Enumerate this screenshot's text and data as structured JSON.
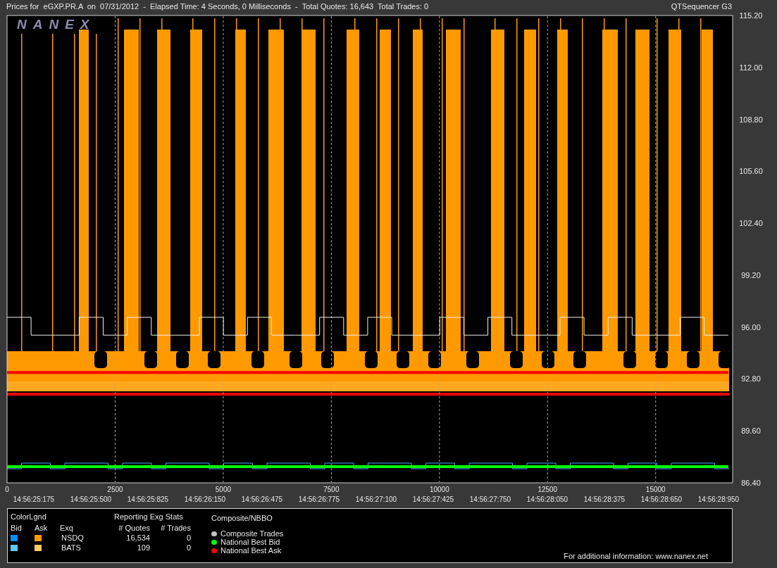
{
  "header": {
    "title": "Prices for  eGXP.PR.A  on  07/31/2012  -  Elapsed Time: 4 Seconds, 0 Milliseconds  -  Total Quotes: 16,643  Total Trades: 0",
    "app": "QTSequencer G3"
  },
  "chart": {
    "logo": "NANEX",
    "time_labels": [
      "14:56:25:175",
      "14:56:25:500",
      "14:56:25:825",
      "14:56:26:150",
      "14:56:26:475",
      "14:56:26:775",
      "14:56:27:100",
      "14:56:27:425",
      "14:56:27:750",
      "14:56:28:050",
      "14:56:28:375",
      "14:56:28:650",
      "14:56:28:950"
    ],
    "chart_data": {
      "type": "line",
      "grid": true,
      "xlim": [
        0,
        16780
      ],
      "ylim": [
        86.4,
        115.2
      ],
      "xticks": [
        0,
        2500,
        5000,
        7500,
        10000,
        12500,
        15000
      ],
      "yticks": [
        {
          "value": 86.4,
          "label": "86.40"
        },
        {
          "value": 89.6,
          "label": "89.60"
        },
        {
          "value": 92.8,
          "label": "92.80"
        },
        {
          "value": 96,
          "label": "96.00"
        },
        {
          "value": 99.2,
          "label": "99.20"
        },
        {
          "value": 102.4,
          "label": "102.40"
        },
        {
          "value": 105.6,
          "label": "105.60"
        },
        {
          "value": 108.8,
          "label": "108.80"
        },
        {
          "value": 112,
          "label": "112.00"
        },
        {
          "value": 115.2,
          "label": "115.20"
        }
      ],
      "x": [
        0,
        556,
        556,
        1112,
        1112,
        1668,
        1668,
        2224,
        2224,
        2780,
        2780,
        3336,
        3336,
        3892,
        3892,
        4448,
        4448,
        5004,
        5004,
        5560,
        5560,
        6116,
        6116,
        6672,
        6672,
        7228,
        7228,
        7784,
        7784,
        8340,
        8340,
        8896,
        8896,
        9452,
        9452,
        10008,
        10008,
        10564,
        10564,
        11120,
        11120,
        11676,
        11676,
        12232,
        12232,
        12788,
        12788,
        13344,
        13344,
        13900,
        13900,
        14456,
        14456,
        15012,
        15012,
        15568,
        15568,
        16124,
        16124,
        16680
      ],
      "series": [
        {
          "color": "#f0f0f0",
          "values": [
            96.6,
            96.6,
            95.5,
            95.5,
            95.5,
            95.5,
            96.6,
            96.6,
            95.5,
            95.5,
            96.6,
            96.6,
            95.5,
            95.5,
            95.5,
            95.5,
            96.6,
            96.6,
            95.5,
            95.5,
            96.6,
            96.6,
            95.5,
            95.5,
            95.5,
            95.5,
            96.6,
            96.6,
            95.5,
            95.5,
            96.6,
            96.6,
            95.5,
            95.5,
            95.5,
            95.5,
            96.6,
            96.6,
            95.5,
            95.5,
            96.6,
            96.6,
            95.5,
            95.5,
            95.5,
            95.5,
            96.6,
            96.6,
            95.5,
            95.5,
            96.6,
            96.6,
            95.5,
            95.5,
            95.5,
            95.5,
            96.6,
            96.6,
            95.5,
            95.5
          ]
        },
        {
          "name": "National Best Bid",
          "color": "#00ff00",
          "values": [
            87.4,
            87.4,
            87.4,
            87.4,
            87.4,
            87.4,
            87.4,
            87.4,
            87.4,
            87.4,
            87.4,
            87.4,
            87.4,
            87.4,
            87.4,
            87.4,
            87.4,
            87.4,
            87.4,
            87.4,
            87.4,
            87.4,
            87.4,
            87.4,
            87.4,
            87.4,
            87.4,
            87.4,
            87.4,
            87.4,
            87.4,
            87.4,
            87.4,
            87.4,
            87.4,
            87.4,
            87.4,
            87.4,
            87.4,
            87.4,
            87.4,
            87.4,
            87.4,
            87.4,
            87.4,
            87.4,
            87.4,
            87.4,
            87.4,
            87.4,
            87.4,
            87.4,
            87.4,
            87.4,
            87.4,
            87.4,
            87.4,
            87.4,
            87.4,
            87.4
          ]
        },
        {
          "name": "National Best Ask",
          "color": "#ff0000",
          "values": [
            93.2,
            93.2,
            93.2,
            93.2,
            93.2,
            93.2,
            93.2,
            93.2,
            93.2,
            93.2,
            93.2,
            93.2,
            93.2,
            93.2,
            93.2,
            93.2,
            93.2,
            93.2,
            93.2,
            93.2,
            93.2,
            93.2,
            93.2,
            93.2,
            93.2,
            93.2,
            93.2,
            93.2,
            93.2,
            93.2,
            93.2,
            93.2,
            93.2,
            93.2,
            93.2,
            93.2,
            93.2,
            93.2,
            93.2,
            93.2,
            93.2,
            93.2,
            93.2,
            93.2,
            93.2,
            93.2,
            93.2,
            93.2,
            93.2,
            93.2,
            93.2,
            93.2,
            93.2,
            93.2,
            93.2,
            93.2,
            93.2,
            93.2,
            93.2,
            93.2
          ]
        }
      ]
    }
  },
  "legend": {
    "color_title": "ColorLgnd",
    "bid_label": "Bid",
    "ask_label": "Ask",
    "exq_label": "Exq",
    "stats_title": "Reporting Exg Stats",
    "quotes_label": "# Quotes",
    "trades_label": "# Trades",
    "exchanges": [
      {
        "name": "NSDQ",
        "swatches": [
          {
            "color": "#0a8cf0"
          },
          {
            "color": "#ff9900"
          }
        ],
        "quotes": "16,534",
        "trades": "0"
      },
      {
        "name": "BATS",
        "swatches": [
          {
            "color": "#5ec8f5"
          },
          {
            "color": "#ffc864"
          }
        ],
        "quotes": "109",
        "trades": "0"
      }
    ],
    "nbbo_title": "Composite/NBBO",
    "nbbo_items": [
      {
        "label": "Composite Trades",
        "color": "#c0c0c0"
      }
    ],
    "footer": "For additional information: www.nanex.net"
  }
}
